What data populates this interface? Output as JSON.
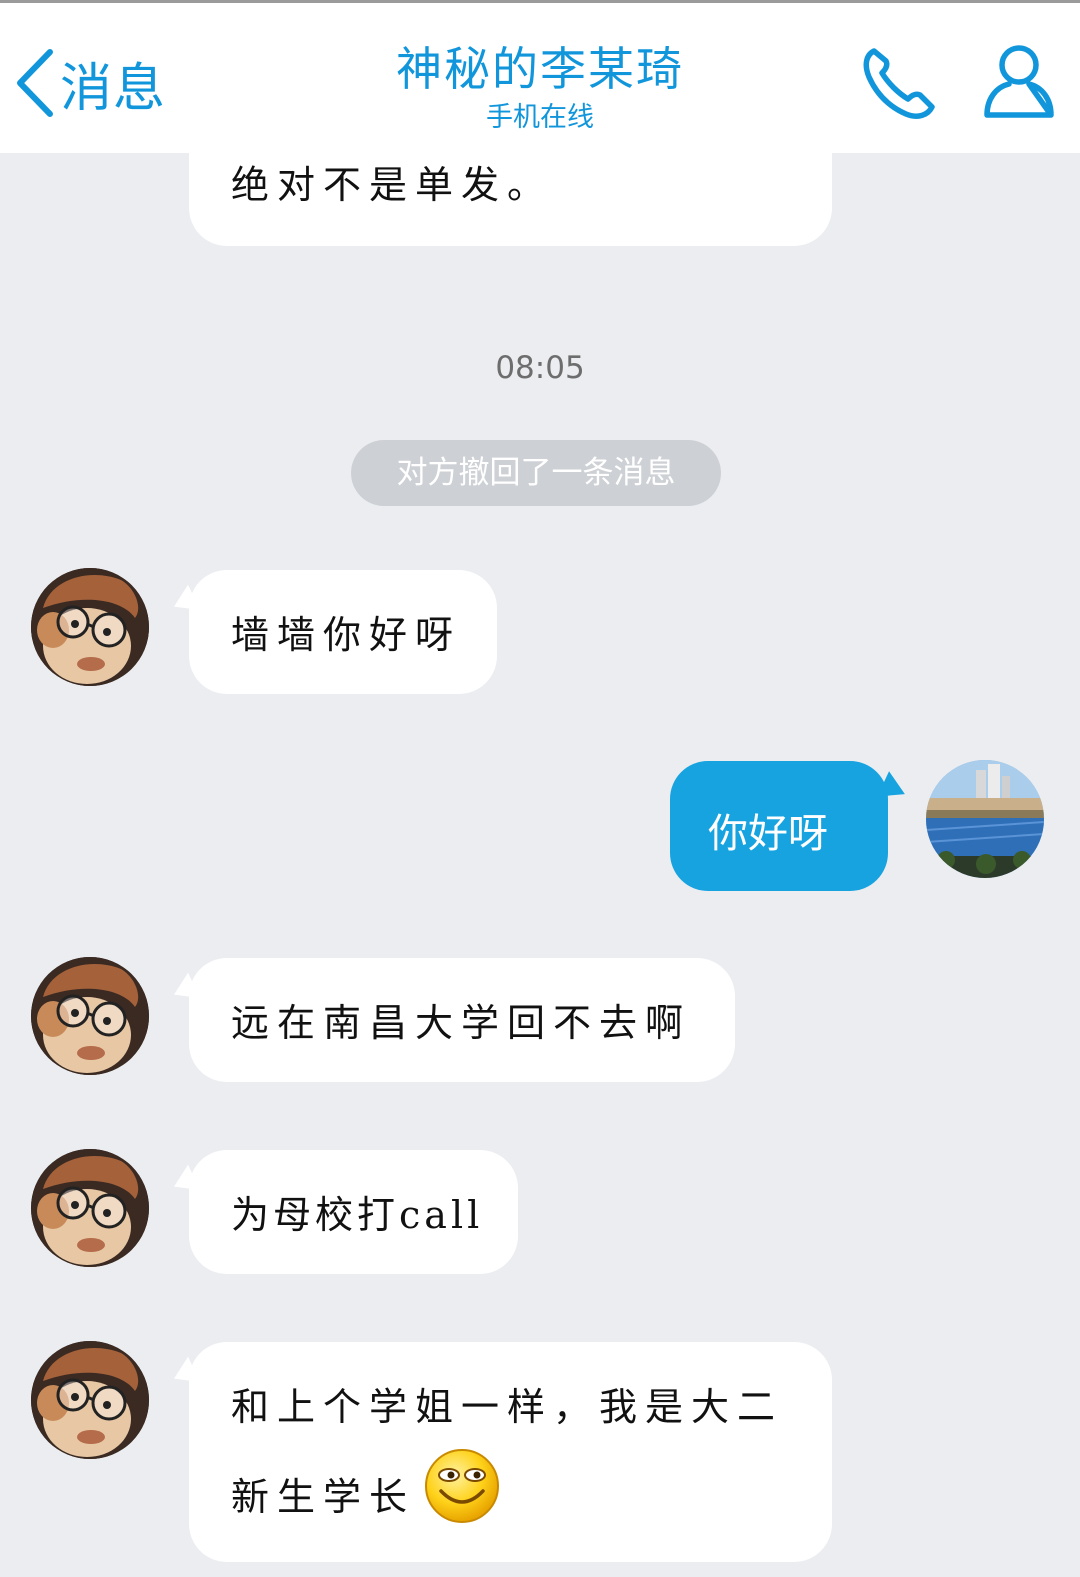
{
  "header": {
    "back_label": "消息",
    "title": "神秘的李某琦",
    "subtitle": "手机在线",
    "call_icon": "phone-icon",
    "profile_icon": "user-profile-icon",
    "accent_color": "#1296db"
  },
  "messages": {
    "partial_prev": "绝对不是单发。",
    "timestamp": "08:05",
    "recall_notice": "对方撤回了一条消息",
    "m1": "墙墙你好呀",
    "m2_out": "你好呀",
    "m3": "远在南昌大学回不去啊",
    "m4": "为母校打call",
    "m5_line1": "和上个学姐一样，我是大二",
    "m5_line2": "新生学长",
    "m5_emoji": "grinning-smiley-emoji"
  },
  "colors": {
    "chat_background": "#ebedf1",
    "outgoing_bubble": "#17a3e0",
    "incoming_bubble": "#ffffff",
    "recall_pill": "#cdd0d4"
  }
}
